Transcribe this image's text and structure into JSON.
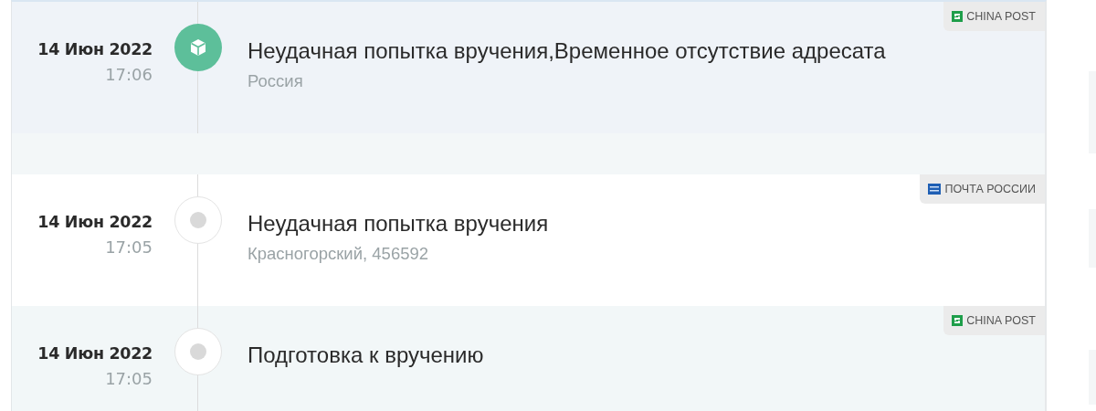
{
  "events": [
    {
      "date": "14 Июн 2022",
      "time": "17:06",
      "title": "Неудачная попытка вручения,Временное отсутствие адресата",
      "location": "Россия",
      "active": true,
      "carrier": {
        "kind": "china_post",
        "name": "CHINA POST"
      }
    },
    {
      "date": "14 Июн 2022",
      "time": "17:05",
      "title": "Неудачная попытка вручения",
      "location": "Красногорский, 456592",
      "active": false,
      "carrier": {
        "kind": "russian_post",
        "name": "ПОЧТА РОССИИ"
      }
    },
    {
      "date": "14 Июн 2022",
      "time": "17:05",
      "title": "Подготовка к вручению",
      "active": false,
      "carrier": {
        "kind": "china_post",
        "name": "CHINA POST"
      }
    }
  ]
}
